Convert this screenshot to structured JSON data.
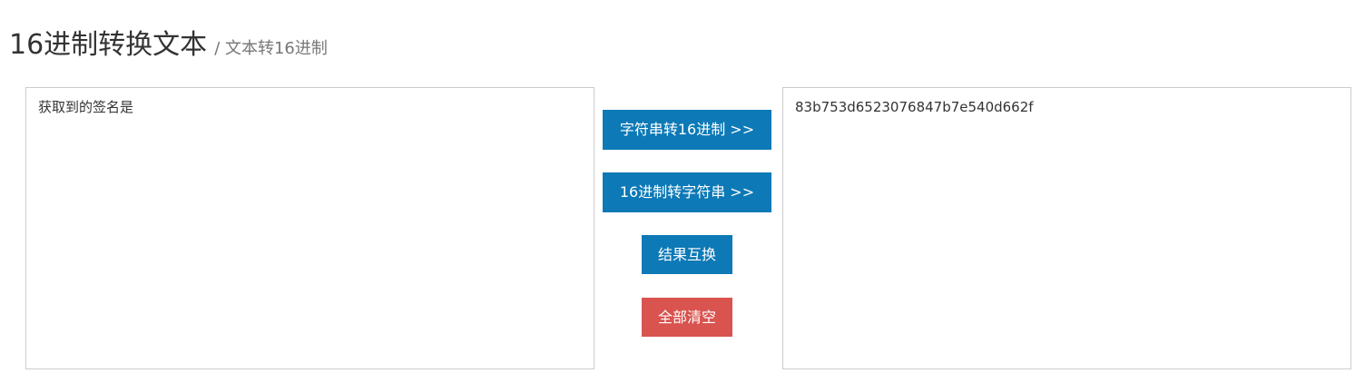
{
  "header": {
    "title": "16进制转换文本",
    "subtitle": "/ 文本转16进制"
  },
  "input_panel": {
    "value": "获取到的签名是"
  },
  "output_panel": {
    "value": "83b753d6523076847b7e540d662f"
  },
  "actions": {
    "string_to_hex_label": "字符串转16进制 >>",
    "hex_to_string_label": "16进制转字符串 >>",
    "swap_label": "结果互换",
    "clear_label": "全部清空"
  },
  "colors": {
    "primary_button": "#0d79b6",
    "danger_button": "#d9534f",
    "panel_border": "#cccccc"
  }
}
